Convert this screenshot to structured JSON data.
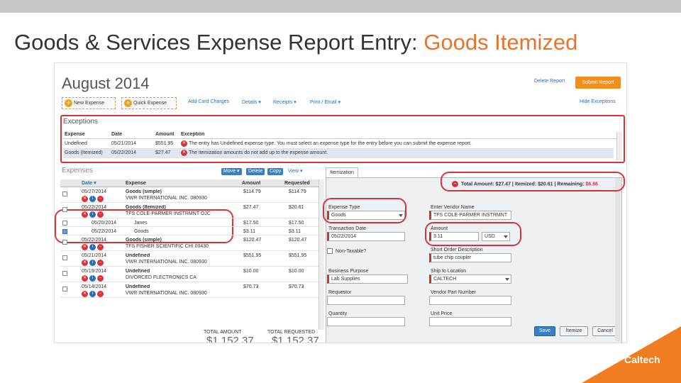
{
  "slide": {
    "title_main": "Goods & Services Expense Report Entry: ",
    "title_highlight": "Goods Itemized",
    "logo_text": "Caltech"
  },
  "report": {
    "month": "August 2014",
    "delete_label": "Delete Report",
    "submit_label": "Submit Report",
    "new_expense_label": "New Expense",
    "quick_expense_label": "Quick Expense",
    "links": [
      "Add Card Charges",
      "Details ▾",
      "Receipts ▾",
      "Print / Email ▾"
    ],
    "hide_exceptions": "Hide Exceptions"
  },
  "exceptions": {
    "label": "Exceptions",
    "headers": [
      "Expense",
      "Date",
      "Amount",
      "Exception"
    ],
    "rows": [
      {
        "expense": "Undefined",
        "date": "05/21/2014",
        "amount": "$551.95",
        "text": "The entry has Undefined expense type. You must select an expense type for the entry before you can submit the expense report."
      },
      {
        "expense": "Goods (Itemized)",
        "date": "05/22/2014",
        "amount": "$27.47",
        "text": "The itemization amounts do not add up to the expense amount."
      }
    ]
  },
  "expenses": {
    "label": "Expenses",
    "toolbar": [
      "Move ▾",
      "Delete",
      "Copy",
      "View ▾"
    ],
    "headers": [
      "Date ▾",
      "Expense",
      "Amount",
      "Requested"
    ],
    "rows": [
      {
        "date": "05/27/2014",
        "expense": "Goods (simple)",
        "vendor": "VWR INTERNATIONAL INC. 080930",
        "amount": "$114.79",
        "requested": "$114.79",
        "checked": false
      },
      {
        "date": "05/22/2014",
        "expense": "Goods (Itemized)",
        "vendor": "TFS COLE-PARMER INSTRMNT OJC",
        "amount": "$27.47",
        "requested": "$20.61",
        "checked": false
      },
      {
        "date": "05/20/2014",
        "expense": "Janes",
        "vendor": "",
        "amount": "$17.50",
        "requested": "$17.50",
        "checked": false,
        "item": true
      },
      {
        "date": "05/22/2014",
        "expense": "Goods",
        "vendor": "",
        "amount": "$3.11",
        "requested": "$3.11",
        "checked": true,
        "item": true
      },
      {
        "date": "05/22/2014",
        "expense": "Goods (simple)",
        "vendor": "TFS FISHER SCIENTIFIC CHI 00430",
        "amount": "$120.47",
        "requested": "$120.47",
        "checked": false
      },
      {
        "date": "05/21/2014",
        "expense": "Undefined",
        "vendor": "VWR INTERNATIONAL INC. 080930",
        "amount": "$551.95",
        "requested": "$551.95",
        "checked": false
      },
      {
        "date": "05/19/2014",
        "expense": "Undefined",
        "vendor": "DIVORCED FLECTRONICS CA",
        "amount": "$10.00",
        "requested": "$10.00",
        "checked": false
      },
      {
        "date": "05/14/2014",
        "expense": "Undefined",
        "vendor": "VWR INTERNATIONAL INC. 080930",
        "amount": "$70.73",
        "requested": "$70.73",
        "checked": false
      }
    ],
    "total_amount_label": "TOTAL AMOUNT",
    "total_requested_label": "TOTAL REQUESTED",
    "total_amount": "$1,152.37",
    "total_requested": "$1,152.37"
  },
  "detail": {
    "tab": "Itemization",
    "summary_total": "Total Amount: $27.47",
    "summary_itemized": "Itemized: $20.61",
    "summary_remaining_label": "Remaining:",
    "summary_remaining": "$6.86",
    "expense_type_label": "Expense Type",
    "expense_type": "Goods",
    "vendor_label": "Enter Vendor Name",
    "vendor": "TFS COLE-PARMER INSTRMNT",
    "txn_date_label": "Transaction Date",
    "txn_date": "05/22/2014",
    "amount_label": "Amount",
    "amount": "3.11",
    "currency": "USD",
    "non_taxable_label": "Non-Taxable?",
    "short_desc_label": "Short Order Description",
    "short_desc": "tube chip coupler",
    "business_purpose_label": "Business Purpose",
    "business_purpose": "Lab Supplies",
    "ship_to_label": "Ship to Location",
    "ship_to": "CALTECH",
    "requestor_label": "Requestor",
    "part_number_label": "Vendor Part Number",
    "quantity_label": "Quantity",
    "unit_price_label": "Unit Price",
    "save": "Save",
    "itemize": "Itemize",
    "cancel": "Cancel"
  },
  "colors": {
    "accent": "#e8732a",
    "highlight_circle": "#d9333a",
    "submit": "#f08f1e",
    "primary_blue": "#3a7fc4"
  }
}
